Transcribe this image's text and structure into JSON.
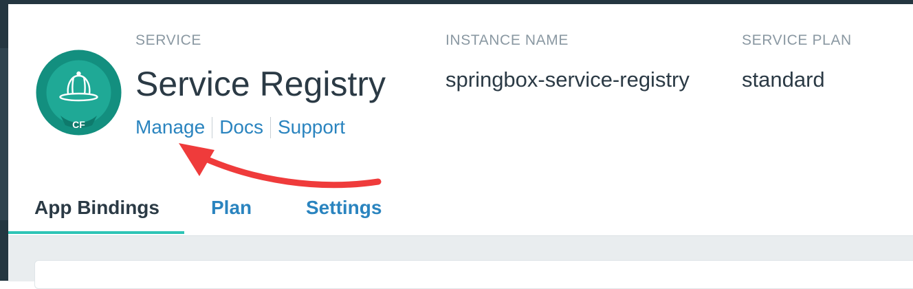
{
  "service": {
    "label": "SERVICE",
    "name": "Service Registry",
    "logo_badge": "CF",
    "links": {
      "manage": "Manage",
      "docs": "Docs",
      "support": "Support"
    }
  },
  "instance": {
    "label": "INSTANCE NAME",
    "value": "springbox-service-registry"
  },
  "plan": {
    "label": "SERVICE PLAN",
    "value": "standard"
  },
  "tabs": [
    {
      "label": "App Bindings",
      "active": true
    },
    {
      "label": "Plan",
      "active": false
    },
    {
      "label": "Settings",
      "active": false
    }
  ],
  "colors": {
    "accent_teal": "#2ec4b6",
    "link_blue": "#2a84bf",
    "annotation_red": "#ef3b3b",
    "logo_green": "#138f7f"
  },
  "icons": {
    "logo": "hat-icon",
    "annotation": "red-arrow-annotation"
  }
}
